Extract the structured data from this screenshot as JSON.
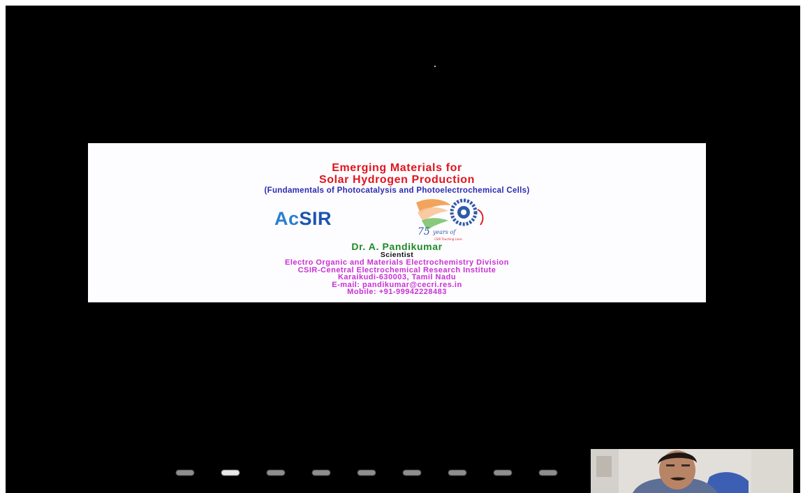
{
  "slide": {
    "title_line1": "Emerging Materials for",
    "title_line2": "Solar Hydrogen Production",
    "subtitle": "(Fundamentals of Photocatalysis and Photoelectrochemical Cells)",
    "logo_acsir": {
      "ac": "Ac",
      "s": "S",
      "ir": "IR"
    },
    "logo_csir": {
      "text_75": "75",
      "years_text": "years of",
      "tagline": "CSIR Touching Lives"
    },
    "presenter_name": "Dr. A. Pandikumar",
    "presenter_role": "Scientist",
    "division": "Electro Organic and Materials Electrochemistry Division",
    "institute": "CSIR-Cenetral Electrochemical Research Institute",
    "address": "Karaikudi-630003, Tamil Nadu",
    "email": "E-mail: pandikumar@cecri.res.in",
    "mobile": "Mobile: +91-99942228483"
  },
  "pager": {
    "count": 9,
    "active_index": 1
  },
  "colors": {
    "background": "#000000",
    "slide_bg": "#fdfcff",
    "title": "#e0151d",
    "subtitle": "#2b2bb0",
    "name": "#1d8a25",
    "info": "#c92fd4",
    "acsir_blue": "#2a7fd0"
  }
}
